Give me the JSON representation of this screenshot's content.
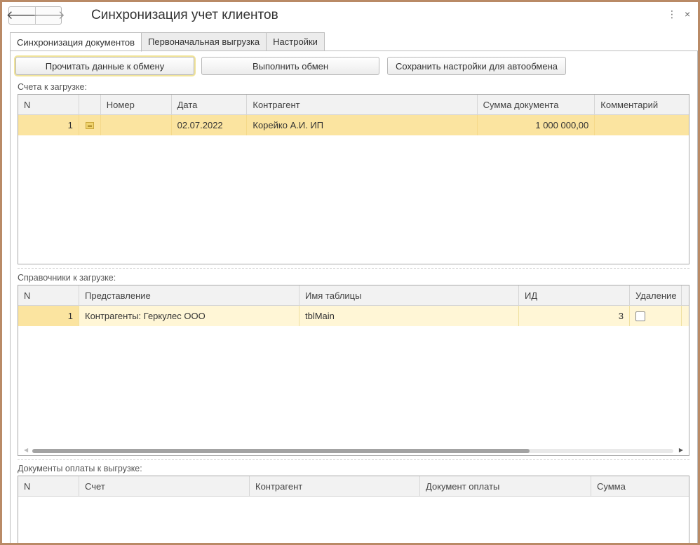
{
  "window": {
    "title": "Синхронизация учет клиентов"
  },
  "nav": {
    "back": "🡐",
    "forward": "🡒",
    "more": "⋮",
    "close": "×"
  },
  "tabs": [
    {
      "label": "Синхронизация документов"
    },
    {
      "label": "Первоначальная выгрузка"
    },
    {
      "label": "Настройки"
    }
  ],
  "buttons": {
    "read": "Прочитать данные к обмену",
    "exchange": "Выполнить обмен",
    "save": "Сохранить настройки для автообмена"
  },
  "invoices": {
    "label": "Счета к загрузке:",
    "headers": [
      "N",
      "",
      "Номер",
      "Дата",
      "Контрагент",
      "Сумма документа",
      "Комментарий"
    ],
    "rows": [
      {
        "n": "1",
        "number": "",
        "date": "02.07.2022",
        "counterparty": "Корейко А.И. ИП",
        "amount": "1 000 000,00",
        "comment": ""
      }
    ]
  },
  "catalogs": {
    "label": "Справочники к загрузке:",
    "headers": [
      "N",
      "Представление",
      "Имя таблицы",
      "ИД",
      "Удаление"
    ],
    "rows": [
      {
        "n": "1",
        "view": "Контрагенты: Геркулес ООО",
        "table": "tblMain",
        "id": "3"
      }
    ]
  },
  "payments": {
    "label": "Документы оплаты к выгрузке:",
    "headers": [
      "N",
      "Счет",
      "Контрагент",
      "Документ оплаты",
      "Сумма"
    ]
  }
}
